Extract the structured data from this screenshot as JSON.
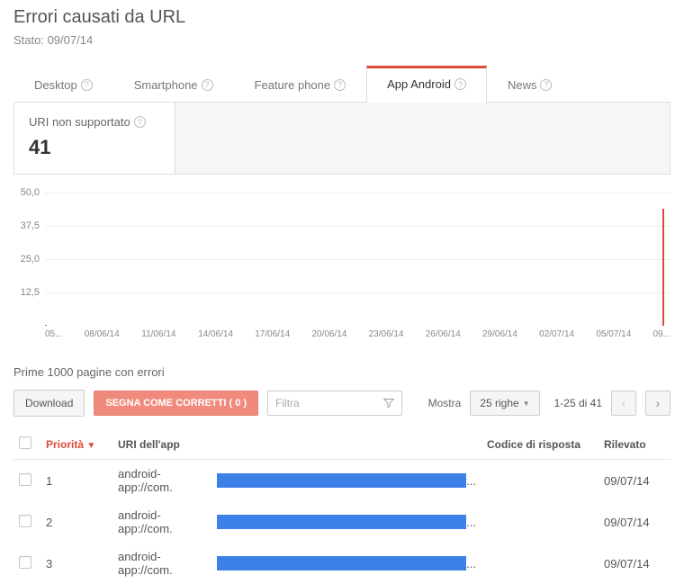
{
  "header": {
    "title": "Errori causati da URL",
    "status_prefix": "Stato: ",
    "status_date": "09/07/14"
  },
  "tabs": [
    {
      "label": "Desktop",
      "active": false
    },
    {
      "label": "Smartphone",
      "active": false
    },
    {
      "label": "Feature phone",
      "active": false
    },
    {
      "label": "App Android",
      "active": true
    },
    {
      "label": "News",
      "active": false
    }
  ],
  "summary": {
    "label": "URI non supportato",
    "value": "41"
  },
  "chart_data": {
    "type": "line",
    "title": "",
    "xlabel": "",
    "ylabel": "",
    "ylim": [
      0,
      50
    ],
    "yticks": [
      12.5,
      25.0,
      37.5,
      50.0
    ],
    "ytick_labels": [
      "12,5",
      "25,0",
      "37,5",
      "50,0"
    ],
    "categories": [
      "05...",
      "08/06/14",
      "11/06/14",
      "14/06/14",
      "17/06/14",
      "20/06/14",
      "23/06/14",
      "26/06/14",
      "29/06/14",
      "02/07/14",
      "05/07/14",
      "09..."
    ],
    "values": [
      0,
      0,
      0,
      0,
      0,
      0,
      0,
      0,
      0,
      0,
      0,
      44
    ]
  },
  "section_label": "Prime 1000 pagine con errori",
  "toolbar": {
    "download": "Download",
    "mark_fixed": "SEGNA COME CORRETTI ( 0 )",
    "filter_placeholder": "Filtra",
    "show_label": "Mostra",
    "rows_label": "25 righe",
    "pager": "1-25 di 41"
  },
  "table": {
    "headers": {
      "priority": "Priorità",
      "uri": "URI dell'app",
      "response_code": "Codice di risposta",
      "detected": "Rilevato"
    },
    "rows": [
      {
        "priority": "1",
        "uri_prefix": "android-app://com.",
        "uri_suffix": "...",
        "response": "",
        "detected": "09/07/14"
      },
      {
        "priority": "2",
        "uri_prefix": "android-app://com.",
        "uri_suffix": "...",
        "response": "",
        "detected": "09/07/14"
      },
      {
        "priority": "3",
        "uri_prefix": "android-app://com.",
        "uri_suffix": "...",
        "response": "",
        "detected": "09/07/14"
      }
    ]
  }
}
